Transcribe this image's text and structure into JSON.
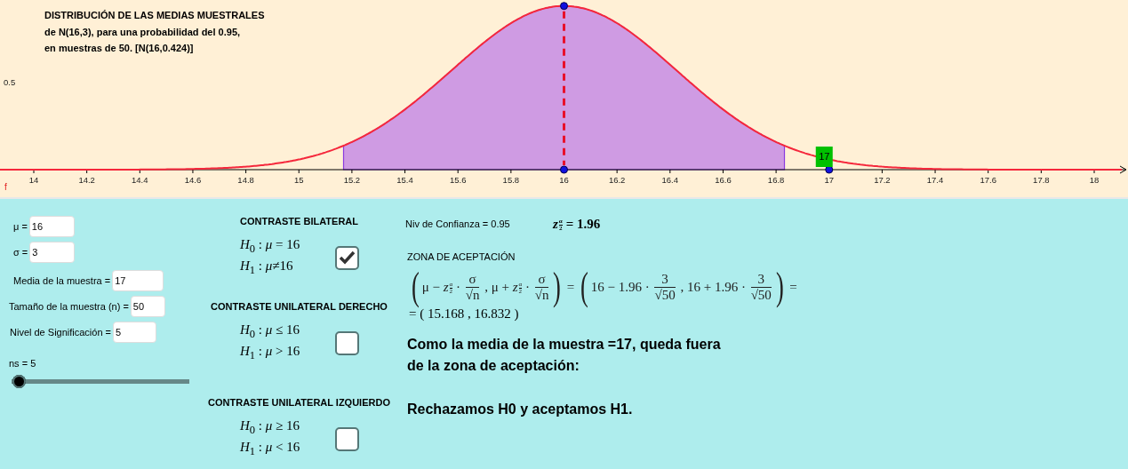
{
  "graph": {
    "title_lines": [
      "DISTRIBUCIÓN DE LAS MEDIAS MUESTRALES",
      "de N(16,3), para una probabilidad del 0.95,",
      "en muestras de 50. [N(16,0.424)]"
    ],
    "y_label": "0.5",
    "function_label": "f",
    "x_labels": [
      "14",
      "14.2",
      "14.4",
      "14.6",
      "14.8",
      "15",
      "15.2",
      "15.4",
      "15.6",
      "15.8",
      "16",
      "16.2",
      "16.4",
      "16.6",
      "16.8",
      "17",
      "17.2",
      "17.4",
      "17.6",
      "17.8",
      "18"
    ],
    "point_label": "17"
  },
  "inputs": [
    {
      "label": "μ =",
      "value": "16"
    },
    {
      "label": "σ =",
      "value": "3"
    },
    {
      "label": "Media de la muestra =",
      "value": "17"
    },
    {
      "label": "Tamaño de la muestra (n) =",
      "value": "50"
    },
    {
      "label": "Nivel de Significación =",
      "value": "5"
    }
  ],
  "slider": {
    "label": "ns = 5",
    "level": 0.04
  },
  "tests": [
    {
      "heading": "CONTRASTE BILATERAL",
      "hypotheses": [
        "*H*$_{0}$ : *μ* = 16",
        "*H*$_{1}$ : *μ*≠16"
      ],
      "checked": true
    },
    {
      "heading": "CONTRASTE UNILATERAL DERECHO",
      "hypotheses": [
        "*H*$_{0}$ : *μ* ≤ 16",
        "*H*$_{1}$ : *μ* > 16"
      ],
      "checked": false
    },
    {
      "heading": "CONTRASTE UNILATERAL IZQUIERDO",
      "hypotheses": [
        "*H*$_{0}$ : *μ* ≥ 16",
        "*H*$_{1}$ : *μ* < 16"
      ],
      "checked": false
    }
  ],
  "confidence": {
    "label": "Niv de Confianza = 0.95",
    "z_symbol": {
      "text": "z",
      "num": "α",
      "den": "2"
    },
    "z_value": "= 1.96"
  },
  "acceptance": {
    "heading": "ZONA DE ACEPTACIÓN",
    "formula": [
      {
        "kind": "paren",
        "text": "("
      },
      {
        "kind": "text",
        "text": "μ − "
      },
      {
        "kind": "z",
        "text": "z",
        "num": "α",
        "den": "2"
      },
      {
        "kind": "text",
        "text": " · "
      },
      {
        "kind": "frac",
        "num": "σ",
        "den": "√n"
      },
      {
        "kind": "text",
        "text": " , μ + "
      },
      {
        "kind": "z",
        "text": "z",
        "num": "α",
        "den": "2"
      },
      {
        "kind": "text",
        "text": " · "
      },
      {
        "kind": "frac",
        "num": "σ",
        "den": "√n"
      },
      {
        "kind": "paren",
        "text": ")"
      },
      {
        "kind": "text",
        "text": " = "
      },
      {
        "kind": "paren",
        "text": "("
      },
      {
        "kind": "text",
        "text": "16 − 1.96 · "
      },
      {
        "kind": "frac",
        "num": "3",
        "den": "√50"
      },
      {
        "kind": "text",
        "text": " , 16 + 1.96 · "
      },
      {
        "kind": "frac",
        "num": "3",
        "den": "√50"
      },
      {
        "kind": "paren",
        "text": ")"
      },
      {
        "kind": "text",
        "text": " ="
      }
    ],
    "result": "= ( 15.168 , 16.832 )"
  },
  "conclusion": {
    "lines": [
      "Como la media de la muestra =17, queda fuera",
      "de la zona de aceptación:"
    ],
    "decision": "Rechazamos H0 y aceptamos H1."
  }
}
